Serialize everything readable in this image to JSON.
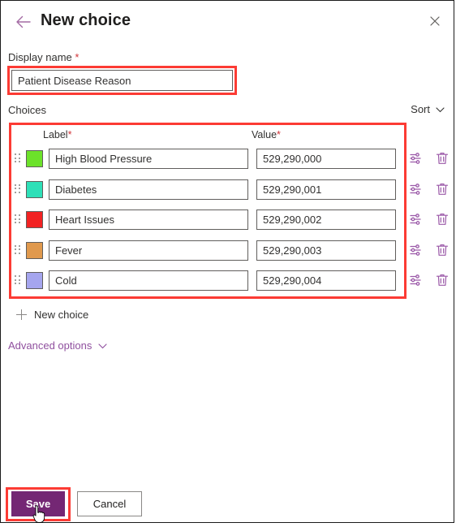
{
  "header": {
    "title": "New choice",
    "back_icon": "back-arrow-icon",
    "close_icon": "close-icon"
  },
  "display_name": {
    "label": "Display name",
    "required_marker": "*",
    "value": "Patient Disease Reason",
    "placeholder": ""
  },
  "choices_section": {
    "label": "Choices",
    "sort_label": "Sort",
    "sort_icon": "chevron-down-icon",
    "columns": {
      "label": "Label",
      "value": "Value",
      "required_marker": "*"
    },
    "rows": [
      {
        "color": "#6ce22a",
        "label": "High Blood Pressure",
        "value": "529,290,000"
      },
      {
        "color": "#2ee0b8",
        "label": "Diabetes",
        "value": "529,290,001"
      },
      {
        "color": "#f22222",
        "label": "Heart Issues",
        "value": "529,290,002"
      },
      {
        "color": "#e0994d",
        "label": "Fever",
        "value": "529,290,003"
      },
      {
        "color": "#a5a5ee",
        "label": "Cold",
        "value": "529,290,004"
      }
    ],
    "row_settings_icon": "sliders-icon",
    "row_delete_icon": "trash-icon",
    "drag_icon": "drag-handle-icon"
  },
  "new_choice": {
    "label": "New choice",
    "icon": "plus-icon"
  },
  "advanced_options": {
    "label": "Advanced options",
    "icon": "chevron-down-icon"
  },
  "footer": {
    "save_label": "Save",
    "cancel_label": "Cancel"
  },
  "colors": {
    "accent_purple": "#742774",
    "link_purple": "#8f4f9e",
    "highlight_red": "#fc3b34",
    "required_red": "#d13438"
  }
}
